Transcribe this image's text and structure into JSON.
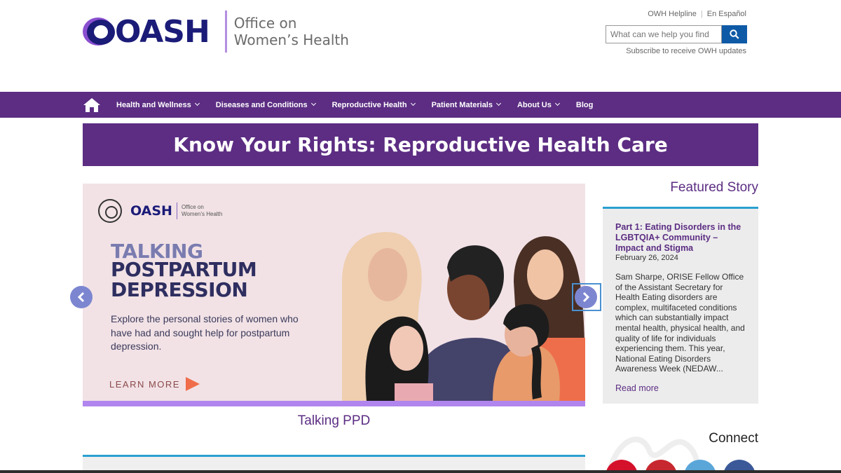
{
  "header": {
    "logo_text": "OASH",
    "logo_sub_line1": "Office on",
    "logo_sub_line2": "Women’s Health",
    "util_links": [
      "OWH Helpline",
      "En Español"
    ],
    "search_placeholder": "What can we help you find",
    "subscribe_label": "Subscribe to receive OWH updates"
  },
  "nav": {
    "items": [
      {
        "label": "Health and Wellness",
        "has_dropdown": true
      },
      {
        "label": "Diseases and Conditions",
        "has_dropdown": true
      },
      {
        "label": "Reproductive Health",
        "has_dropdown": true
      },
      {
        "label": "Patient Materials",
        "has_dropdown": true
      },
      {
        "label": "About Us",
        "has_dropdown": true
      },
      {
        "label": "Blog",
        "has_dropdown": false
      }
    ]
  },
  "banner": {
    "text": "Know Your Rights: Reproductive Health Care"
  },
  "carousel": {
    "slide": {
      "logo_text": "OASH",
      "logo_sub_line1": "Office on",
      "logo_sub_line2": "Women’s Health",
      "title_line1": "TALKING",
      "title_line2": "POSTPARTUM DEPRESSION",
      "body": "Explore the personal stories of women who have had and sought help for postpartum depression.",
      "cta": "LEARN MORE"
    },
    "caption": "Talking PPD"
  },
  "featured": {
    "heading": "Featured Story",
    "title": "Part 1: Eating Disorders in the LGBTQIA+ Community – Impact and Stigma",
    "date": "February 26, 2024",
    "excerpt": "Sam Sharpe, ORISE Fellow Office of the Assistant Secretary for Health Eating disorders are complex, multifaceted conditions which can substantially impact mental health, physical health, and quality of life for individuals experiencing them. This year, National Eating Disorders Awareness Week (NEDAW...",
    "read_more": "Read more"
  },
  "connect": {
    "heading": "Connect"
  },
  "colors": {
    "brand_purple": "#5c2d83",
    "accent_blue": "#2aa0d0",
    "search_button": "#0f5aa6",
    "slide_bg": "#f2e2e6"
  },
  "icons": [
    "home-icon",
    "search-icon",
    "chevron-down-icon",
    "arrow-left-icon",
    "arrow-right-icon"
  ]
}
